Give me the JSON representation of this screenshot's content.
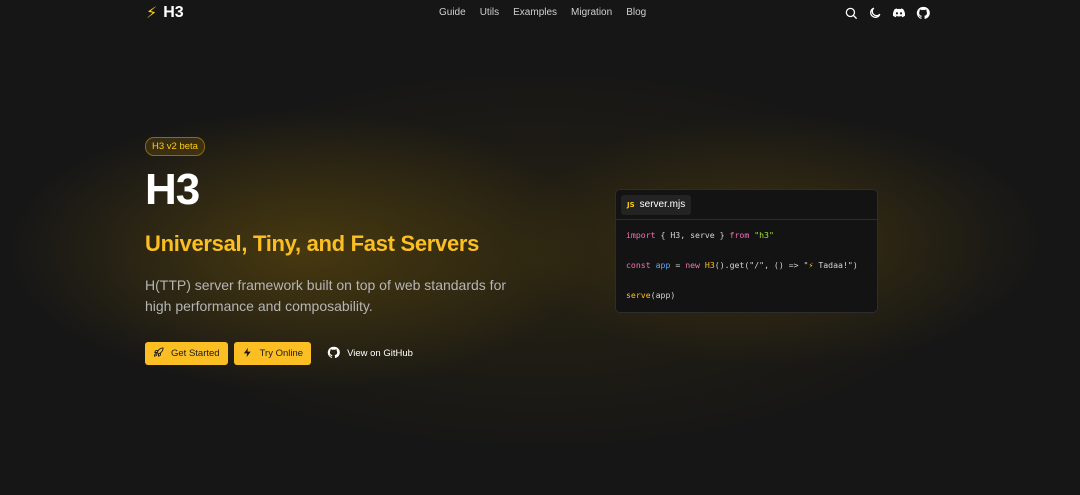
{
  "header": {
    "logo_text": "H3",
    "logo_icon": "lightning-bolt-icon",
    "nav": [
      "Guide",
      "Utils",
      "Examples",
      "Migration",
      "Blog"
    ],
    "icons": [
      "search-icon",
      "moon-icon",
      "discord-icon",
      "github-icon"
    ]
  },
  "hero": {
    "badge": "H3 v2 beta",
    "title": "H3",
    "subtitle": "Universal, Tiny, and Fast Servers",
    "description": "H(TTP) server framework built on top of web standards for high performance and composability.",
    "buttons": {
      "get_started": "Get Started",
      "try_online": "Try Online",
      "github": "View on GitHub"
    }
  },
  "code": {
    "tab_badge": "JS",
    "filename": "server.mjs",
    "line1": {
      "import": "import",
      "braces_open": " { ",
      "names": "H3, serve",
      "braces_close": " } ",
      "from": "from",
      "module": "\"h3\""
    },
    "line2": {
      "const": "const",
      "app": "app",
      "eq": " = ",
      "new": "new",
      "cls": "H3",
      "call": "().get(\"/\", () => \"",
      "emoji": "⚡",
      "msg": " Tadaa!\")"
    },
    "line3": {
      "fn": "serve",
      "args": "(app)"
    }
  },
  "colors": {
    "accent": "#fbbf24",
    "background": "#161616"
  }
}
